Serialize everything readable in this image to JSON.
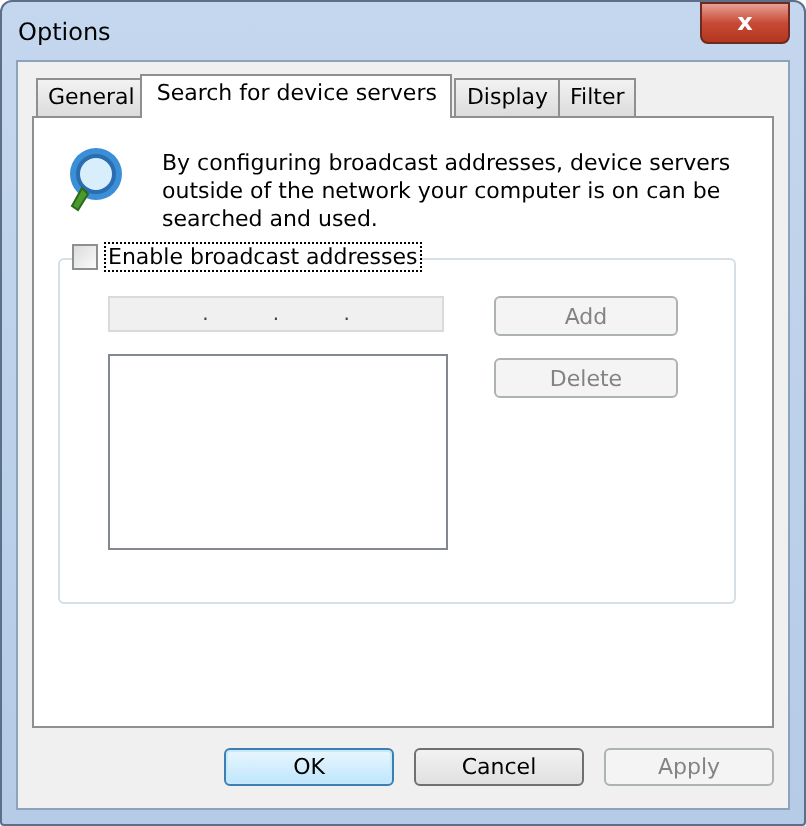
{
  "window": {
    "title": "Options",
    "close": "x"
  },
  "tabs": [
    {
      "label": "General",
      "selected": false
    },
    {
      "label": "Search for device servers",
      "selected": true
    },
    {
      "label": "Display",
      "selected": false
    },
    {
      "label": "Filter",
      "selected": false
    }
  ],
  "info_text": "By configuring broadcast addresses, device servers outside of the network your computer is on can be searched and used.",
  "broadcast": {
    "label": "Enable broadcast addresses",
    "checked": false
  },
  "ip_field": {
    "separators": [
      ".",
      ".",
      "."
    ],
    "disabled": true
  },
  "side_buttons": [
    {
      "label": "Add",
      "disabled": true
    },
    {
      "label": "Delete",
      "disabled": true
    }
  ],
  "buttons": [
    {
      "label": "OK",
      "disabled": false,
      "default": true
    },
    {
      "label": "Cancel",
      "disabled": false,
      "default": false
    },
    {
      "label": "Apply",
      "disabled": true,
      "default": false
    }
  ]
}
